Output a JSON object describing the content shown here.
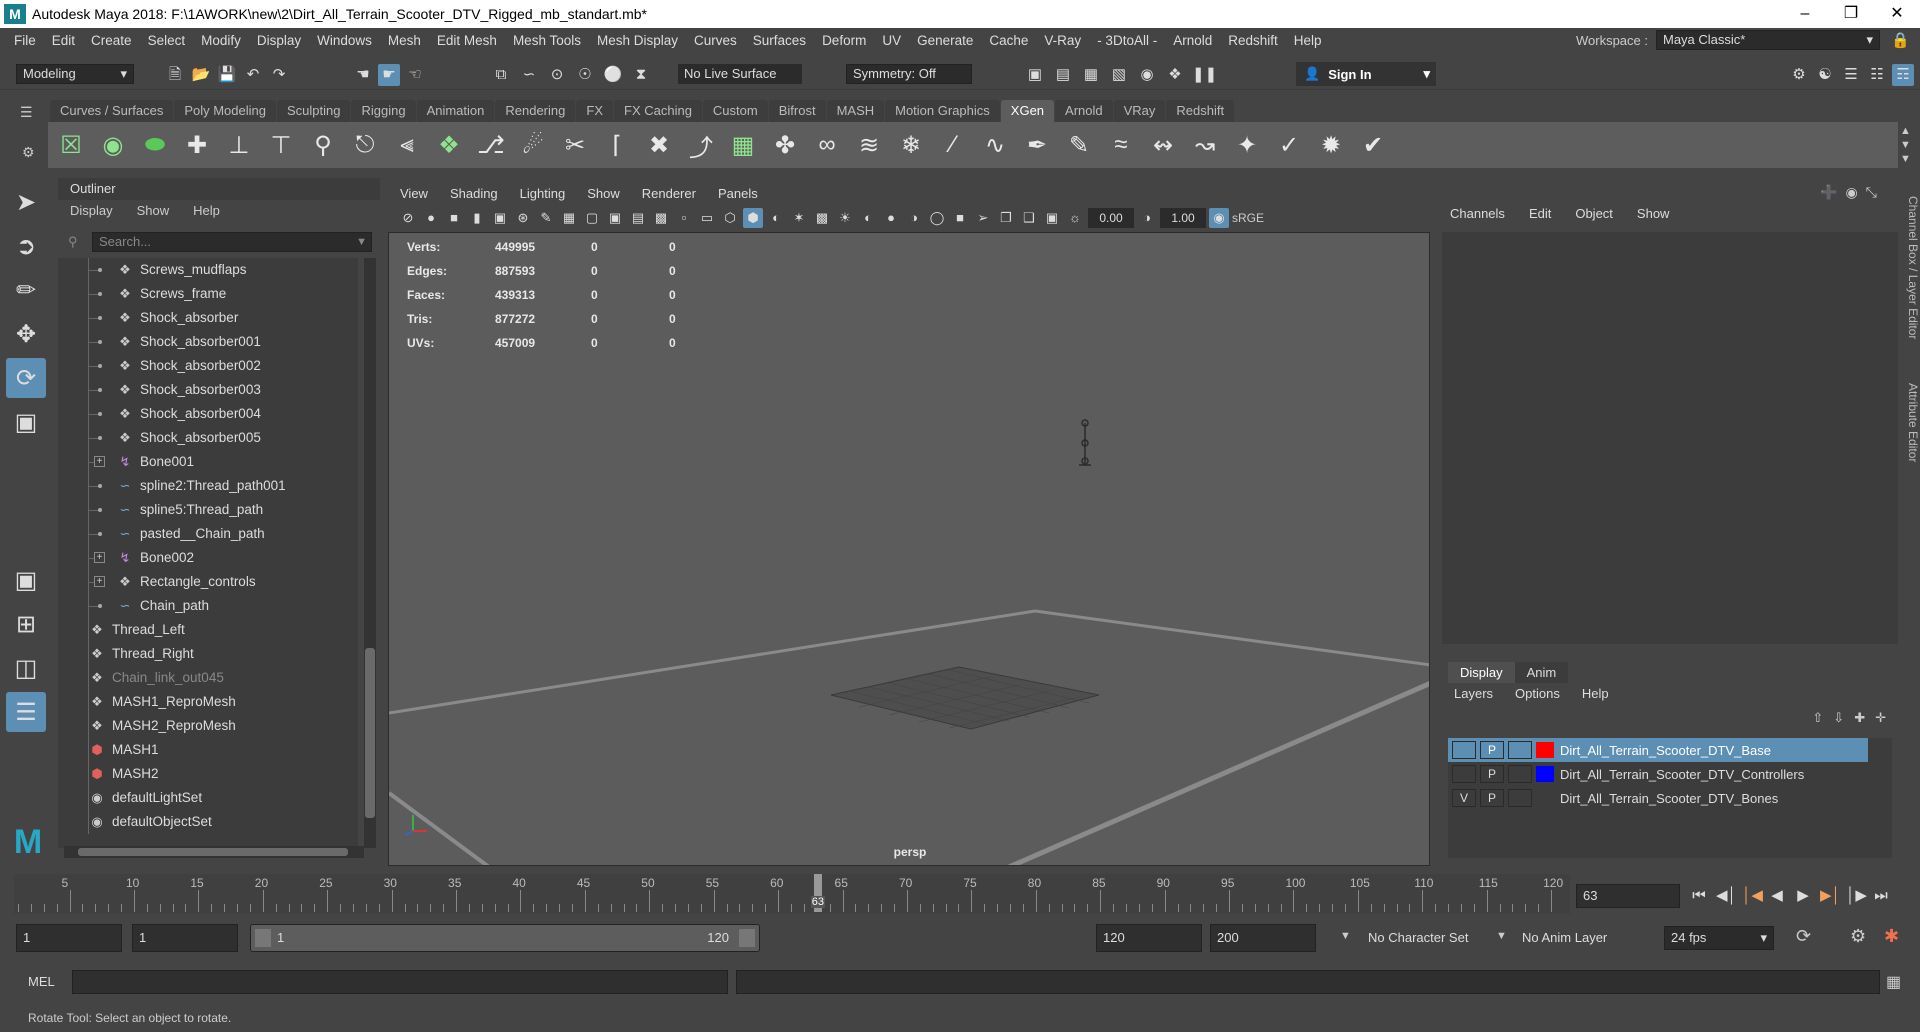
{
  "window": {
    "title": "Autodesk Maya 2018: F:\\1AWORK\\new\\2\\Dirt_All_Terrain_Scooter_DTV_Rigged_mb_standart.mb*",
    "logo": "M"
  },
  "menu": [
    "File",
    "Edit",
    "Create",
    "Select",
    "Modify",
    "Display",
    "Windows",
    "Mesh",
    "Edit Mesh",
    "Mesh Tools",
    "Mesh Display",
    "Curves",
    "Surfaces",
    "Deform",
    "UV",
    "Generate",
    "Cache",
    "V-Ray",
    "- 3DtoAll -",
    "Arnold",
    "Redshift",
    "Help"
  ],
  "workspace": {
    "label": "Workspace :",
    "value": "Maya Classic*"
  },
  "status": {
    "mode": "Modeling",
    "live_surface": "No Live Surface",
    "symmetry": "Symmetry: Off",
    "sign_in": "Sign In"
  },
  "shelf_tabs": [
    "Curves / Surfaces",
    "Poly Modeling",
    "Sculpting",
    "Rigging",
    "Animation",
    "Rendering",
    "FX",
    "FX Caching",
    "Custom",
    "Bifrost",
    "MASH",
    "Motion Graphics",
    "XGen",
    "Arnold",
    "VRay",
    "Redshift"
  ],
  "shelf_active": "XGen",
  "outliner": {
    "title": "Outliner",
    "menu": [
      "Display",
      "Show",
      "Help"
    ],
    "search_placeholder": "Search...",
    "rows": [
      {
        "label": "Screws_mudflaps",
        "icon": "mesh-icon",
        "indent": 1,
        "expand": false,
        "dim": false
      },
      {
        "label": "Screws_frame",
        "icon": "mesh-icon",
        "indent": 1,
        "expand": false,
        "dim": false
      },
      {
        "label": "Shock_absorber",
        "icon": "mesh-icon",
        "indent": 1,
        "expand": false,
        "dim": false
      },
      {
        "label": "Shock_absorber001",
        "icon": "mesh-icon",
        "indent": 1,
        "expand": false,
        "dim": false
      },
      {
        "label": "Shock_absorber002",
        "icon": "mesh-icon",
        "indent": 1,
        "expand": false,
        "dim": false
      },
      {
        "label": "Shock_absorber003",
        "icon": "mesh-icon",
        "indent": 1,
        "expand": false,
        "dim": false
      },
      {
        "label": "Shock_absorber004",
        "icon": "mesh-icon",
        "indent": 1,
        "expand": false,
        "dim": false
      },
      {
        "label": "Shock_absorber005",
        "icon": "mesh-icon",
        "indent": 1,
        "expand": false,
        "dim": false
      },
      {
        "label": "Bone001",
        "icon": "bone-icon",
        "indent": 1,
        "expand": true,
        "dim": false
      },
      {
        "label": "spline2:Thread_path001",
        "icon": "curve-icon",
        "indent": 1,
        "expand": false,
        "dim": false
      },
      {
        "label": "spline5:Thread_path",
        "icon": "curve-icon",
        "indent": 1,
        "expand": false,
        "dim": false
      },
      {
        "label": "pasted__Chain_path",
        "icon": "curve-icon",
        "indent": 1,
        "expand": false,
        "dim": false
      },
      {
        "label": "Bone002",
        "icon": "bone-icon",
        "indent": 1,
        "expand": true,
        "dim": false
      },
      {
        "label": "Rectangle_controls",
        "icon": "mesh-icon",
        "indent": 1,
        "expand": true,
        "dim": false
      },
      {
        "label": "Chain_path",
        "icon": "curve-icon",
        "indent": 1,
        "expand": false,
        "dim": false
      },
      {
        "label": "Thread_Left",
        "icon": "mesh-icon",
        "indent": 0,
        "expand": false,
        "dim": false
      },
      {
        "label": "Thread_Right",
        "icon": "mesh-icon",
        "indent": 0,
        "expand": false,
        "dim": false
      },
      {
        "label": "Chain_link_out045",
        "icon": "mesh-icon",
        "indent": 0,
        "expand": false,
        "dim": true
      },
      {
        "label": "MASH1_ReproMesh",
        "icon": "mesh-icon",
        "indent": 0,
        "expand": false,
        "dim": false
      },
      {
        "label": "MASH2_ReproMesh",
        "icon": "mesh-icon",
        "indent": 0,
        "expand": false,
        "dim": false
      },
      {
        "label": "MASH1",
        "icon": "mash-icon",
        "indent": 0,
        "expand": false,
        "dim": false
      },
      {
        "label": "MASH2",
        "icon": "mash-icon",
        "indent": 0,
        "expand": false,
        "dim": false
      },
      {
        "label": "defaultLightSet",
        "icon": "set-icon",
        "indent": 0,
        "expand": false,
        "dim": false
      },
      {
        "label": "defaultObjectSet",
        "icon": "set-icon",
        "indent": 0,
        "expand": false,
        "dim": false
      }
    ]
  },
  "viewport": {
    "menu": [
      "View",
      "Shading",
      "Lighting",
      "Show",
      "Renderer",
      "Panels"
    ],
    "field1": "0.00",
    "field2": "1.00",
    "colorspace": "sRGE",
    "camera": "persp",
    "hud": [
      {
        "k": "Verts:",
        "v1": "449995",
        "v2": "0",
        "v3": "0"
      },
      {
        "k": "Edges:",
        "v1": "887593",
        "v2": "0",
        "v3": "0"
      },
      {
        "k": "Faces:",
        "v1": "439313",
        "v2": "0",
        "v3": "0"
      },
      {
        "k": "Tris:",
        "v1": "877272",
        "v2": "0",
        "v3": "0"
      },
      {
        "k": "UVs:",
        "v1": "457009",
        "v2": "0",
        "v3": "0"
      }
    ]
  },
  "channel_box": {
    "menu": [
      "Channels",
      "Edit",
      "Object",
      "Show"
    ],
    "side_tab": "Channel Box / Layer Editor",
    "side_tab2": "Attribute Editor"
  },
  "layers": {
    "tabs": [
      "Display",
      "Anim"
    ],
    "menu": [
      "Layers",
      "Options",
      "Help"
    ],
    "rows": [
      {
        "v": "",
        "p": "P",
        "color": "#ff0000",
        "name": "Dirt_All_Terrain_Scooter_DTV_Base",
        "selected": true
      },
      {
        "v": "",
        "p": "P",
        "color": "#0000ff",
        "name": "Dirt_All_Terrain_Scooter_DTV_Controllers",
        "selected": false
      },
      {
        "v": "V",
        "p": "P",
        "color": "#3c3c3c",
        "name": "Dirt_All_Terrain_Scooter_DTV_Bones",
        "selected": false
      }
    ]
  },
  "timeline": {
    "labels": [
      "5",
      "10",
      "15",
      "20",
      "25",
      "30",
      "35",
      "40",
      "45",
      "50",
      "55",
      "60",
      "65",
      "70",
      "75",
      "80",
      "85",
      "90",
      "95",
      "100",
      "105",
      "110",
      "115",
      "120"
    ],
    "current": "63",
    "current_field": "63"
  },
  "range": {
    "start": "1",
    "start2": "1",
    "slider_start": "1",
    "slider_end": "120",
    "end": "120",
    "end2": "200",
    "character_set": "No Character Set",
    "anim_layer": "No Anim Layer",
    "fps": "24 fps"
  },
  "cmd": {
    "label": "MEL"
  },
  "help": "Rotate Tool: Select an object to rotate."
}
